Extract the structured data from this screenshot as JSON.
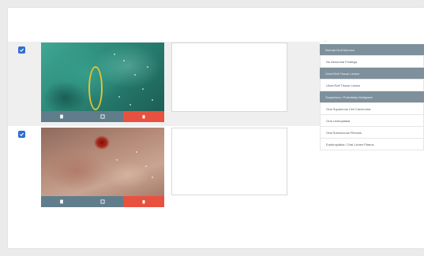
{
  "side_panel": {
    "caption": "—",
    "options": [
      {
        "label": "Normal Oral Mucosa",
        "kind": "header"
      },
      {
        "label": "No Abnormal Findings",
        "kind": "item"
      },
      {
        "label": "Ulcer/Soft Tissue Lesion",
        "kind": "header"
      },
      {
        "label": "Ulcer/Soft Tissue Lesion",
        "kind": "item"
      },
      {
        "label": "Suspicious / Potentially Malignant",
        "kind": "header"
      },
      {
        "label": "Oral Squamous Cell Carcinoma",
        "kind": "item"
      },
      {
        "label": "Oral Leukoplakia",
        "kind": "item"
      },
      {
        "label": "Oral Submucous Fibrosis",
        "kind": "item"
      },
      {
        "label": "Erythroplakia / Oral Lichen Planus",
        "kind": "item"
      }
    ]
  },
  "rows": [
    {
      "checked": true,
      "notes": ""
    },
    {
      "checked": true,
      "notes": ""
    }
  ],
  "colors": {
    "action_bar": "#607d8b",
    "delete": "#e8513f",
    "checkbox": "#2f6fcf",
    "option_header": "#7e909b",
    "annotation": "#e2c334"
  }
}
